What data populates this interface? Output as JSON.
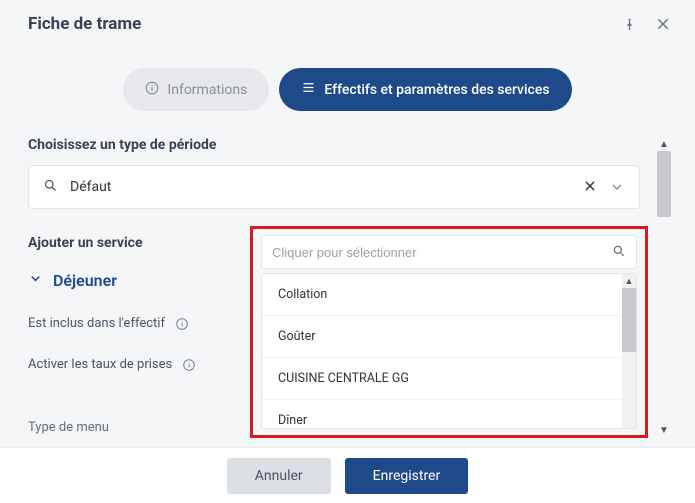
{
  "header": {
    "title": "Fiche de trame"
  },
  "tabs": {
    "informations": "Informations",
    "effectifs": "Effectifs et paramètres des services"
  },
  "period": {
    "label": "Choisissez un type de période",
    "value": "Défaut"
  },
  "add_service": {
    "label": "Ajouter un service"
  },
  "service_combo": {
    "placeholder": "Cliquer pour sélectionner",
    "options": [
      "Collation",
      "Goûter",
      "CUISINE CENTRALE GG",
      "Dîner"
    ]
  },
  "dejeuner": {
    "title": "Déjeuner"
  },
  "settings": {
    "included": "Est inclus dans l'effectif",
    "taux": "Activer les taux de prises",
    "menu_type": "Type de menu"
  },
  "footer": {
    "cancel": "Annuler",
    "save": "Enregistrer"
  }
}
